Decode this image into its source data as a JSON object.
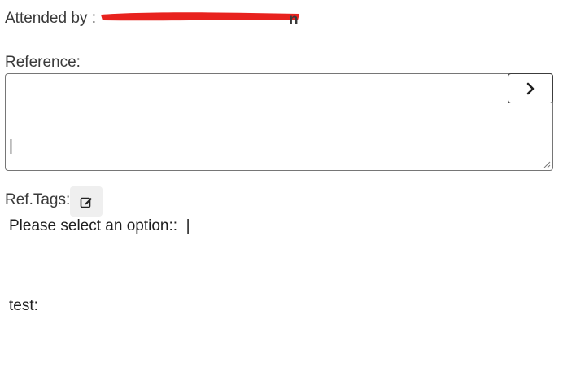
{
  "attended": {
    "label": "Attended by :",
    "name_visible_tail": "n",
    "redaction_color": "#e8221e"
  },
  "reference": {
    "label": "Reference:",
    "lines": [
      "|",
      "Please select an option::  |",
      "test:"
    ],
    "next_button_icon": "chevron-right-icon"
  },
  "tags": {
    "label": "Ref.Tags:",
    "edit_button_icon": "edit-icon"
  }
}
